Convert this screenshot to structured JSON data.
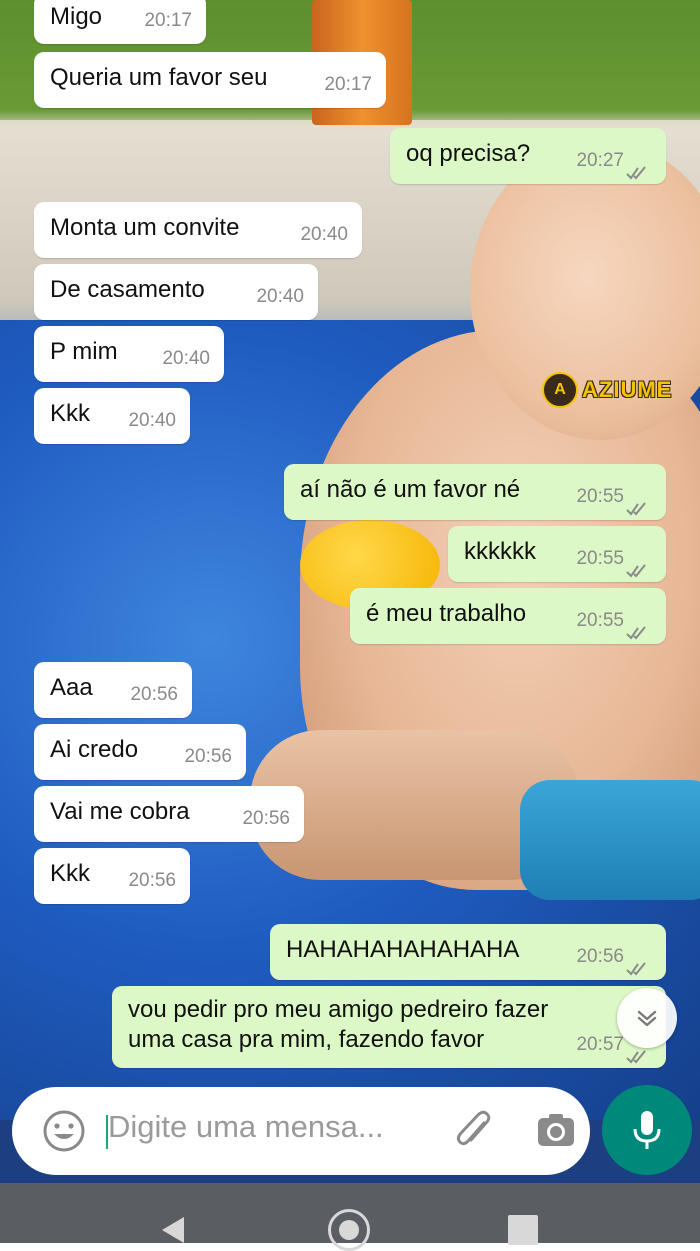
{
  "messages": [
    {
      "dir": "in",
      "text": "Migo",
      "time": "20:17"
    },
    {
      "dir": "in",
      "text": "Queria um favor seu",
      "time": "20:17"
    },
    {
      "dir": "out",
      "text": "oq precisa?",
      "time": "20:27"
    },
    {
      "dir": "in",
      "text": "Monta um convite",
      "time": "20:40"
    },
    {
      "dir": "in",
      "text": "De casamento",
      "time": "20:40"
    },
    {
      "dir": "in",
      "text": "P mim",
      "time": "20:40"
    },
    {
      "dir": "in",
      "text": "Kkk",
      "time": "20:40"
    },
    {
      "dir": "out",
      "text": "aí não é um favor né",
      "time": "20:55"
    },
    {
      "dir": "out",
      "text": "kkkkkk",
      "time": "20:55"
    },
    {
      "dir": "out",
      "text": "é meu trabalho",
      "time": "20:55"
    },
    {
      "dir": "in",
      "text": "Aaa",
      "time": "20:56"
    },
    {
      "dir": "in",
      "text": "Ai credo",
      "time": "20:56"
    },
    {
      "dir": "in",
      "text": "Vai me cobra",
      "time": "20:56"
    },
    {
      "dir": "in",
      "text": "Kkk",
      "time": "20:56"
    },
    {
      "dir": "out",
      "text": "HAHAHAHAHAHAHA",
      "time": "20:56"
    },
    {
      "dir": "out",
      "text_line1": "vou pedir pro meu amigo pedreiro fazer",
      "text_line2": "uma casa pra mim, fazendo favor",
      "time": "20:57"
    }
  ],
  "composer": {
    "placeholder": "Digite uma mensa..."
  },
  "watermark": {
    "text": "AZIUME"
  },
  "colors": {
    "incoming_bubble": "#ffffff",
    "outgoing_bubble": "#dcf8c6",
    "mic_button": "#00897b",
    "ticks": "#8a8a8a"
  },
  "icons": [
    "emoji-icon",
    "attach-icon",
    "camera-icon",
    "mic-icon",
    "chevron-down-icon",
    "double-check-icon",
    "back-icon",
    "home-icon",
    "recents-icon"
  ]
}
